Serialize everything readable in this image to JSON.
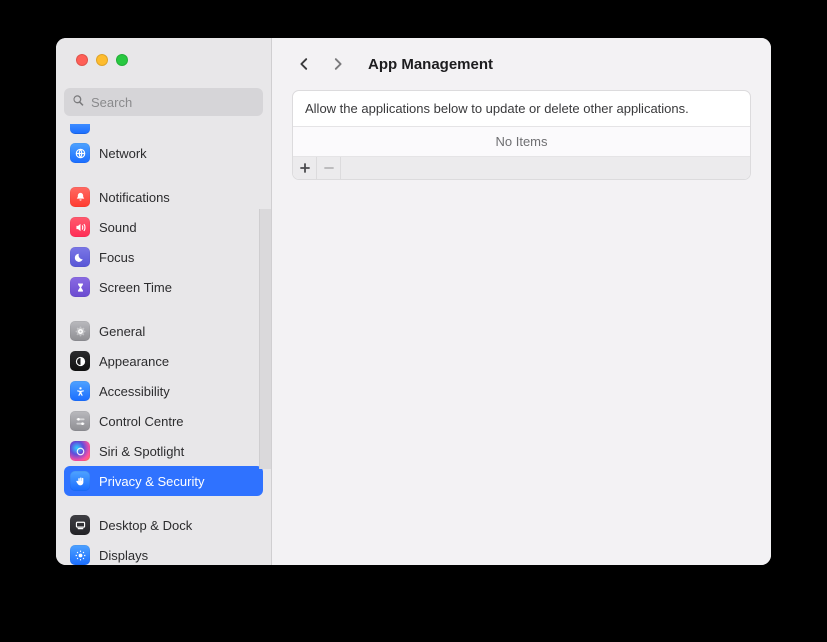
{
  "window": {
    "title": "App Management"
  },
  "search": {
    "placeholder": "Search"
  },
  "sidebar": {
    "items": [
      {
        "label": "Network"
      },
      {
        "label": "Notifications"
      },
      {
        "label": "Sound"
      },
      {
        "label": "Focus"
      },
      {
        "label": "Screen Time"
      },
      {
        "label": "General"
      },
      {
        "label": "Appearance"
      },
      {
        "label": "Accessibility"
      },
      {
        "label": "Control Centre"
      },
      {
        "label": "Siri & Spotlight"
      },
      {
        "label": "Privacy & Security"
      },
      {
        "label": "Desktop & Dock"
      },
      {
        "label": "Displays"
      }
    ]
  },
  "main": {
    "description": "Allow the applications below to update or delete other applications.",
    "empty_text": "No Items"
  }
}
